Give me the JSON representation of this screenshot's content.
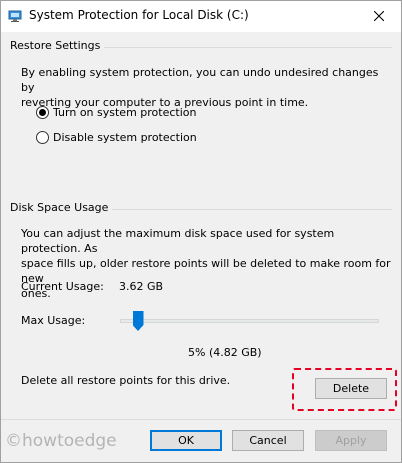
{
  "window": {
    "title": "System Protection for Local Disk (C:)",
    "close_glyph": "close-icon"
  },
  "restore_settings": {
    "group_label": "Restore Settings",
    "description_line1": "By enabling system protection, you can undo undesired changes by",
    "description_line2": "reverting your computer to a previous point in time.",
    "options": [
      {
        "label": "Turn on system protection",
        "selected": true
      },
      {
        "label": "Disable system protection",
        "selected": false
      }
    ]
  },
  "disk_space": {
    "group_label": "Disk Space Usage",
    "description_line1": "You can adjust the maximum disk space used for system protection. As",
    "description_line2": "space fills up, older restore points will be deleted to make room for new",
    "description_line3": "ones.",
    "current_usage_label": "Current Usage:",
    "current_usage_value": "3.62 GB",
    "max_usage_label": "Max Usage:",
    "max_usage_fraction": 0.05,
    "max_usage_readout": "5% (4.82 GB)",
    "delete_text": "Delete all restore points for this drive.",
    "delete_button": "Delete"
  },
  "footer": {
    "watermark": "©howtoedge",
    "ok": "OK",
    "cancel": "Cancel",
    "apply": "Apply"
  },
  "colors": {
    "accent": "#0078d7",
    "highlight": "#e60023"
  }
}
